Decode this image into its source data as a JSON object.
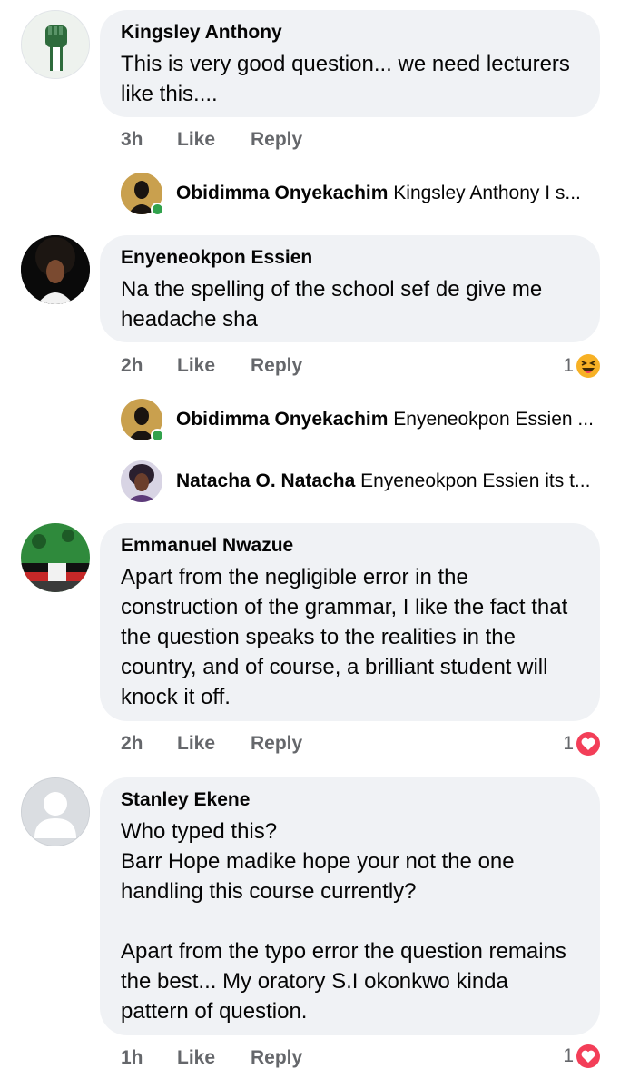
{
  "comments": [
    {
      "author": "Kingsley Anthony",
      "text": "This is very good question... we need lecturers like this....",
      "time": "3h",
      "like": "Like",
      "reply": "Reply",
      "replies": [
        {
          "name": "Obidimma Onyekachim",
          "snippet": "Kingsley Anthony I s...",
          "online": true
        }
      ]
    },
    {
      "author": "Enyeneokpon Essien",
      "text": "Na the spelling of the school sef de give me headache sha",
      "time": "2h",
      "like": "Like",
      "reply": "Reply",
      "reaction_count": "1",
      "reaction_icon": "laughing-emoji-icon",
      "replies": [
        {
          "name": "Obidimma Onyekachim",
          "snippet": "Enyeneokpon Essien ...",
          "online": true
        },
        {
          "name": "Natacha O. Natacha",
          "snippet": "Enyeneokpon Essien  its t...",
          "online": false
        }
      ]
    },
    {
      "author": "Emmanuel Nwazue",
      "text": "Apart from the negligible error in the construction of the grammar, I like the fact that the question speaks to the realities in the country, and of course, a brilliant student will knock it off.",
      "time": "2h",
      "like": "Like",
      "reply": "Reply",
      "reaction_count": "1",
      "reaction_icon": "love-heart-icon"
    },
    {
      "author": "Stanley Ekene",
      "text": "Who typed this?\nBarr Hope madike hope your not the one handling this course currently?\n\nApart from the typo error the question remains the best... My oratory S.I okonkwo kinda pattern of question.",
      "time": "1h",
      "like": "Like",
      "reply": "Reply",
      "reaction_count": "1",
      "reaction_icon": "love-heart-icon"
    }
  ],
  "colors": {
    "bubble": "#f0f2f5",
    "meta": "#65676b",
    "online": "#31a24c",
    "love": "#f33e58",
    "haha": "#f7b125"
  }
}
